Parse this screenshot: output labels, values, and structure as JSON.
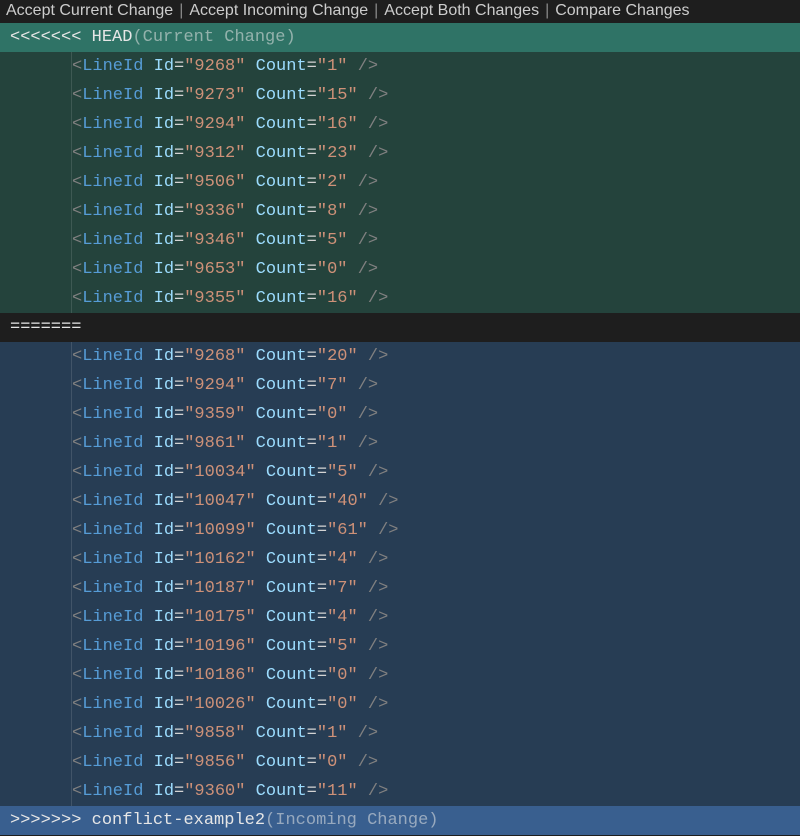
{
  "codelens": {
    "accept_current": "Accept Current Change",
    "accept_incoming": "Accept Incoming Change",
    "accept_both": "Accept Both Changes",
    "compare": "Compare Changes",
    "separator": "|"
  },
  "conflict": {
    "head_marker": "<<<<<<< ",
    "head_branch": "HEAD",
    "head_hint": "(Current Change)",
    "separator": "=======",
    "tail_marker": ">>>>>>> ",
    "tail_branch": "conflict-example2",
    "tail_hint": "(Incoming Change)"
  },
  "xml": {
    "tag": "LineId",
    "attr_id": "Id",
    "attr_count": "Count"
  },
  "current_rows": [
    {
      "id": "9268",
      "count": "1"
    },
    {
      "id": "9273",
      "count": "15"
    },
    {
      "id": "9294",
      "count": "16"
    },
    {
      "id": "9312",
      "count": "23"
    },
    {
      "id": "9506",
      "count": "2"
    },
    {
      "id": "9336",
      "count": "8"
    },
    {
      "id": "9346",
      "count": "5"
    },
    {
      "id": "9653",
      "count": "0"
    },
    {
      "id": "9355",
      "count": "16"
    }
  ],
  "incoming_rows": [
    {
      "id": "9268",
      "count": "20"
    },
    {
      "id": "9294",
      "count": "7"
    },
    {
      "id": "9359",
      "count": "0"
    },
    {
      "id": "9861",
      "count": "1"
    },
    {
      "id": "10034",
      "count": "5"
    },
    {
      "id": "10047",
      "count": "40"
    },
    {
      "id": "10099",
      "count": "61"
    },
    {
      "id": "10162",
      "count": "4"
    },
    {
      "id": "10187",
      "count": "7"
    },
    {
      "id": "10175",
      "count": "4"
    },
    {
      "id": "10196",
      "count": "5"
    },
    {
      "id": "10186",
      "count": "0"
    },
    {
      "id": "10026",
      "count": "0"
    },
    {
      "id": "9858",
      "count": "1"
    },
    {
      "id": "9856",
      "count": "0"
    },
    {
      "id": "9360",
      "count": "11"
    }
  ]
}
